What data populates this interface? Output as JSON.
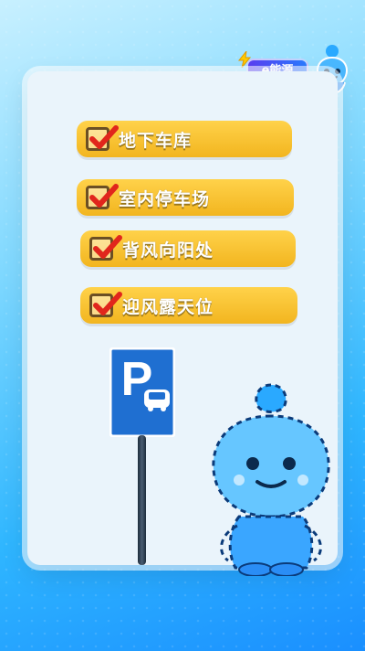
{
  "brand": {
    "badge_text": "e能源",
    "colors": {
      "badge_start": "#5a3ef2",
      "badge_end": "#2a7bff",
      "bolt": "#ffcc00"
    }
  },
  "checklist": [
    {
      "label": "地下车库",
      "checked": true
    },
    {
      "label": "室内停车场",
      "checked": true
    },
    {
      "label": "背风向阳处",
      "checked": true
    },
    {
      "label": "迎风露天位",
      "checked": true
    }
  ],
  "parking_sign": {
    "letter": "P",
    "icon": "car-icon",
    "colors": {
      "sign": "#1f6fd1",
      "border": "#ffffff"
    }
  },
  "icons": {
    "check": "check-mark-icon",
    "brand_bolt": "lightning-icon",
    "mascot": "mascot-icon"
  },
  "colors": {
    "pill_top": "#ffd24a",
    "pill_bottom": "#f2b51f",
    "checkmark": "#e1261c",
    "card": "#eaf4fb",
    "background_top": "#c8f0ff",
    "background_bottom": "#1a8fff"
  }
}
